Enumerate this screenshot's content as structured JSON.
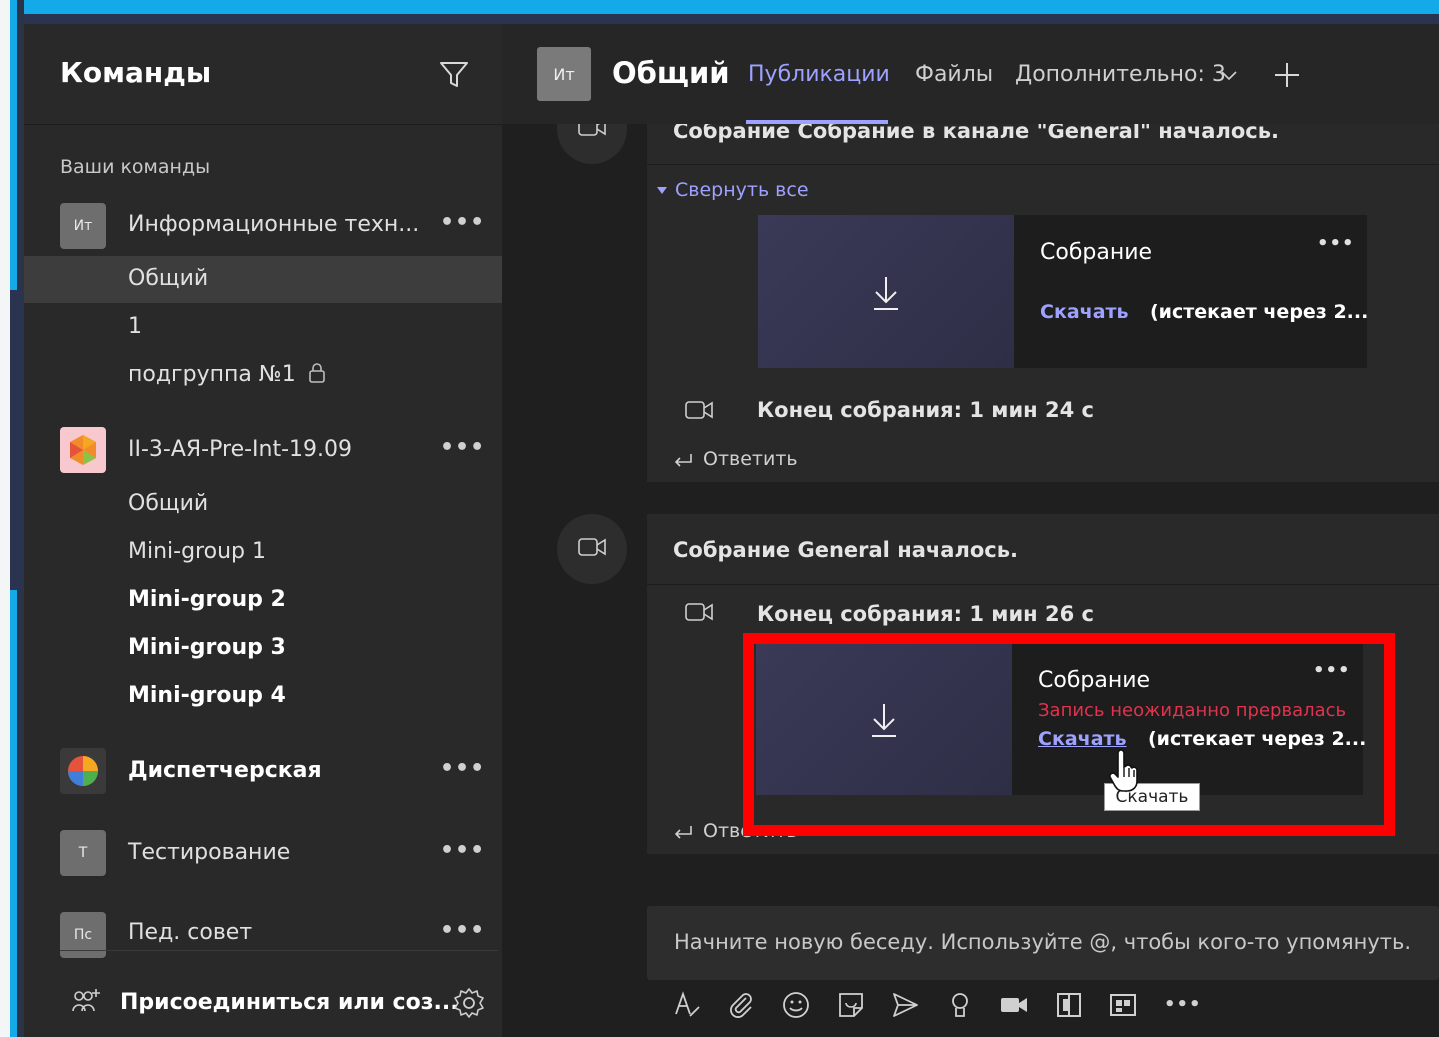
{
  "sidebar": {
    "title": "Команды",
    "section_label": "Ваши команды",
    "teams": [
      {
        "avatar": "Ит",
        "name": "Информационные техн...",
        "channels": [
          "Общий",
          "1",
          "подгруппа №1"
        ]
      },
      {
        "avatar": "",
        "name": "II-3-АЯ-Pre-Int-19.09",
        "channels": [
          "Общий",
          "Mini-group 1",
          "Mini-group 2",
          "Mini-group 3",
          "Mini-group 4"
        ]
      },
      {
        "avatar": "",
        "name": "Диспетчерская"
      },
      {
        "avatar": "Т",
        "name": "Тестирование"
      },
      {
        "avatar": "Пс",
        "name": "Пед. совет"
      }
    ],
    "more": "•••",
    "join_label": "Присоединиться или соз..."
  },
  "header": {
    "channel_avatar": "Ит",
    "channel_title": "Общий",
    "tabs": [
      "Публикации",
      "Файлы",
      "Дополнительно: 3"
    ]
  },
  "feed": {
    "card1": {
      "title": "Собрание Собрание в канале \"General\" началось.",
      "collapse": "Свернуть все",
      "recording": {
        "name": "Собрание",
        "more": "•••",
        "download": "Скачать",
        "expires": "(истекает через 2..."
      },
      "end": "Конец собрания: 1 мин 24 с",
      "reply": "Ответить"
    },
    "card2": {
      "title": "Собрание General началось.",
      "end": "Конец собрания: 1 мин 26 с",
      "recording": {
        "name": "Собрание",
        "more": "•••",
        "error": "Запись неожиданно прервалась",
        "download": "Скачать",
        "expires": "(истекает через 2..."
      },
      "tooltip": "Скачать",
      "reply": "Ответить"
    }
  },
  "composer": {
    "placeholder": "Начните новую беседу. Используйте @, чтобы кого-то упомянуть.",
    "more": "•••"
  },
  "colors": {
    "accent": "#9ea2ff",
    "error": "#e0334d",
    "highlight": "#ff0000",
    "frame": "#14a9e8"
  },
  "icons": [
    "filter-icon",
    "lock-icon",
    "gear-icon",
    "join-team-icon",
    "video-camera-icon",
    "download-icon",
    "reply-icon",
    "plus-icon",
    "chevron-down-icon",
    "format-icon",
    "attach-icon",
    "emoji-icon",
    "sticker-icon",
    "send-icon",
    "praise-icon",
    "meet-now-icon",
    "whiteboard-icon",
    "apps-icon",
    "hand-cursor-icon"
  ]
}
